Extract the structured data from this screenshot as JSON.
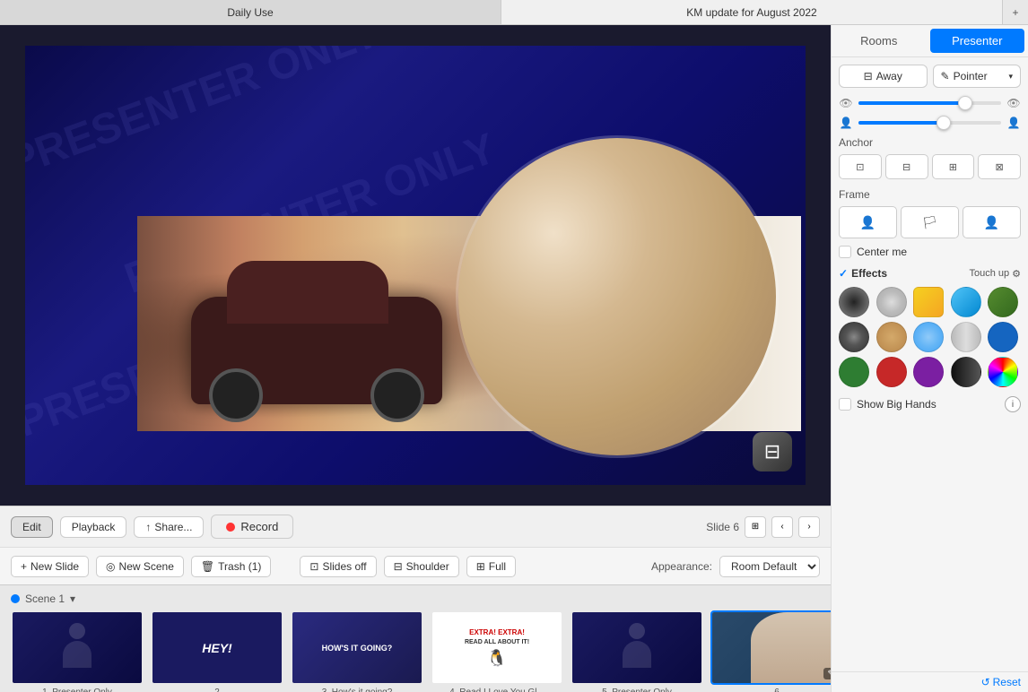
{
  "titlebar": {
    "tab1": "Daily Use",
    "tab2": "KM update for August 2022",
    "plus_label": "+"
  },
  "rightPanel": {
    "tab_rooms": "Rooms",
    "tab_presenter": "Presenter",
    "btn_away": "Away",
    "btn_pointer": "Pointer",
    "slider1_value": 75,
    "slider2_value": 60,
    "anchor_label": "Anchor",
    "frame_label": "Frame",
    "center_me_label": "Center me",
    "center_me_checked": false,
    "effects_label": "Effects",
    "touch_up_label": "Touch up",
    "show_big_hands_label": "Show Big Hands",
    "reset_label": "Reset",
    "effects": [
      {
        "id": "e1",
        "bg": "radial-gradient(circle, #222 0%, #555 50%, #888 100%)",
        "label": "dark-vignette"
      },
      {
        "id": "e2",
        "bg": "radial-gradient(circle, #ddd 0%, #bbb 50%, #aaa 100%)",
        "label": "blur"
      },
      {
        "id": "e3",
        "bg": "linear-gradient(135deg, #f5d020 0%, #f5a623 100%)",
        "label": "yellow-square"
      },
      {
        "id": "e4",
        "bg": "linear-gradient(135deg, #4fc3f7 0%, #0288d1 100%)",
        "label": "blue-circle"
      },
      {
        "id": "e5",
        "bg": "linear-gradient(135deg, #558b2f 0%, #33691e 100%)",
        "label": "green"
      },
      {
        "id": "e6",
        "bg": "radial-gradient(circle, #888 0%, #555 40%, #333 100%)",
        "label": "film"
      },
      {
        "id": "e7",
        "bg": "radial-gradient(circle, #d4a96a 0%, #b8864a 100%)",
        "label": "warm"
      },
      {
        "id": "e8",
        "bg": "radial-gradient(circle, #90caf9 0%, #64b5f6 50%, #42a5f5 100%)",
        "label": "cool"
      },
      {
        "id": "e9",
        "bg": "linear-gradient(to right, #bbb 0%, #ddd 50%, #bbb 100%)",
        "label": "gray"
      },
      {
        "id": "e10",
        "bg": "#1565c0",
        "label": "blue"
      },
      {
        "id": "e11",
        "bg": "#2e7d32",
        "label": "green2"
      },
      {
        "id": "e12",
        "bg": "#c62828",
        "label": "red"
      },
      {
        "id": "e13",
        "bg": "#7b1fa2",
        "label": "purple"
      },
      {
        "id": "e14",
        "bg": "linear-gradient(to right, #111 0%, #333 50%, #555 100%)",
        "label": "black"
      },
      {
        "id": "e15",
        "bg": "conic-gradient(red, yellow, lime, cyan, blue, magenta, red)",
        "label": "rainbow"
      }
    ]
  },
  "toolbar": {
    "edit_label": "Edit",
    "playback_label": "Playback",
    "share_label": "Share...",
    "record_label": "Record",
    "slide_label": "Slide 6",
    "prev_label": "‹",
    "next_label": "›"
  },
  "scenebar": {
    "new_slide_label": "New Slide",
    "new_scene_label": "New Scene",
    "trash_label": "Trash (1)",
    "slides_off_label": "Slides off",
    "shoulder_label": "Shoulder",
    "full_label": "Full",
    "appearance_label": "Appearance:",
    "appearance_value": "Room Default"
  },
  "slidestrip": {
    "scene_label": "Scene 1",
    "slides": [
      {
        "id": 1,
        "label": "1. Presenter Only",
        "type": "presenter-only"
      },
      {
        "id": 2,
        "label": "2",
        "type": "hey"
      },
      {
        "id": 3,
        "label": "3. How's it going?",
        "type": "howsit"
      },
      {
        "id": 4,
        "label": "4. Read I Love You Gl...",
        "type": "read"
      },
      {
        "id": 5,
        "label": "5. Presenter Only",
        "type": "presenter-only"
      },
      {
        "id": 6,
        "label": "6",
        "type": "person",
        "selected": true
      }
    ]
  }
}
